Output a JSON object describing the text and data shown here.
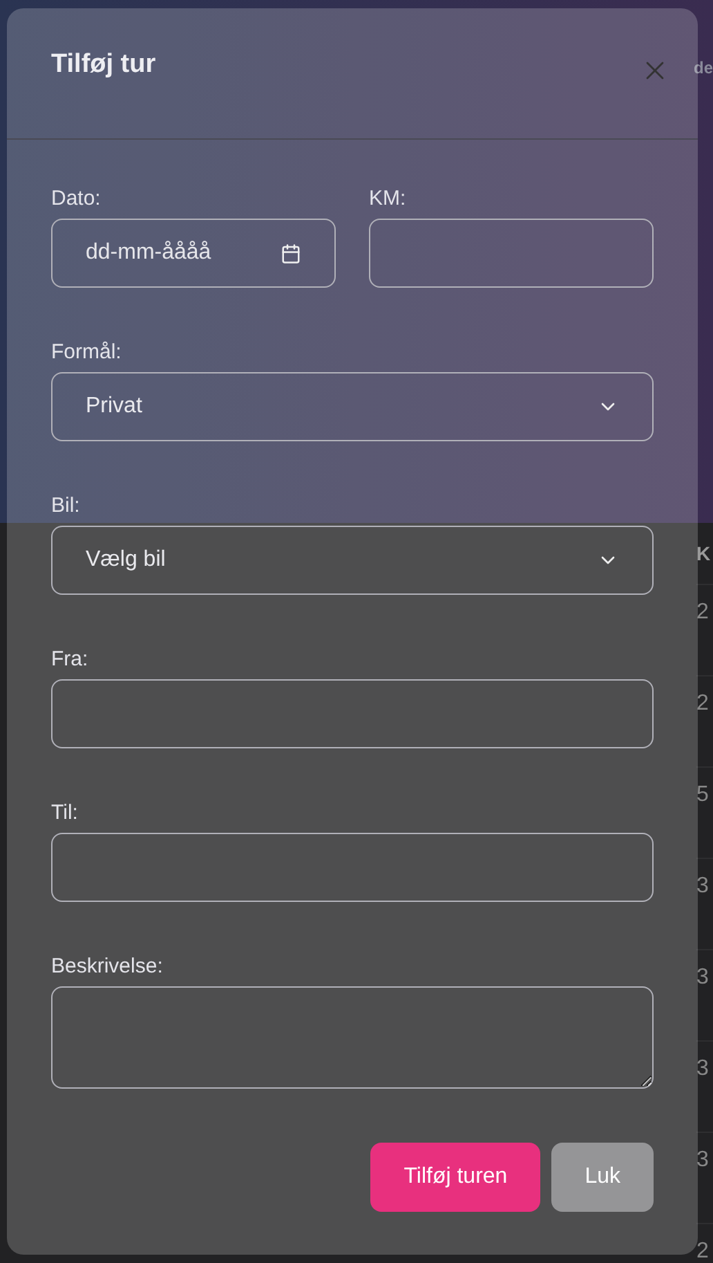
{
  "background": {
    "header_fragment": "de",
    "column_header": "K",
    "column_cells": [
      "2",
      "2",
      "5",
      "3",
      "3",
      "3",
      "3",
      "2"
    ]
  },
  "dialog": {
    "title": "Tilføj tur",
    "fields": [
      {
        "kind": "date",
        "label": "Dato:",
        "placeholder": "dd-mm-åååå"
      },
      {
        "kind": "text",
        "label": "KM:"
      },
      {
        "kind": "select",
        "label": "Formål:",
        "value": "Privat"
      },
      {
        "kind": "select",
        "label": "Bil:",
        "value": "Vælg bil"
      },
      {
        "kind": "text",
        "label": "Fra:"
      },
      {
        "kind": "text",
        "label": "Til:"
      },
      {
        "kind": "textarea",
        "label": "Beskrivelse:"
      }
    ],
    "buttons": [
      {
        "kind": "primary",
        "label": "Tilføj turen"
      },
      {
        "kind": "secondary",
        "label": "Luk"
      }
    ]
  }
}
